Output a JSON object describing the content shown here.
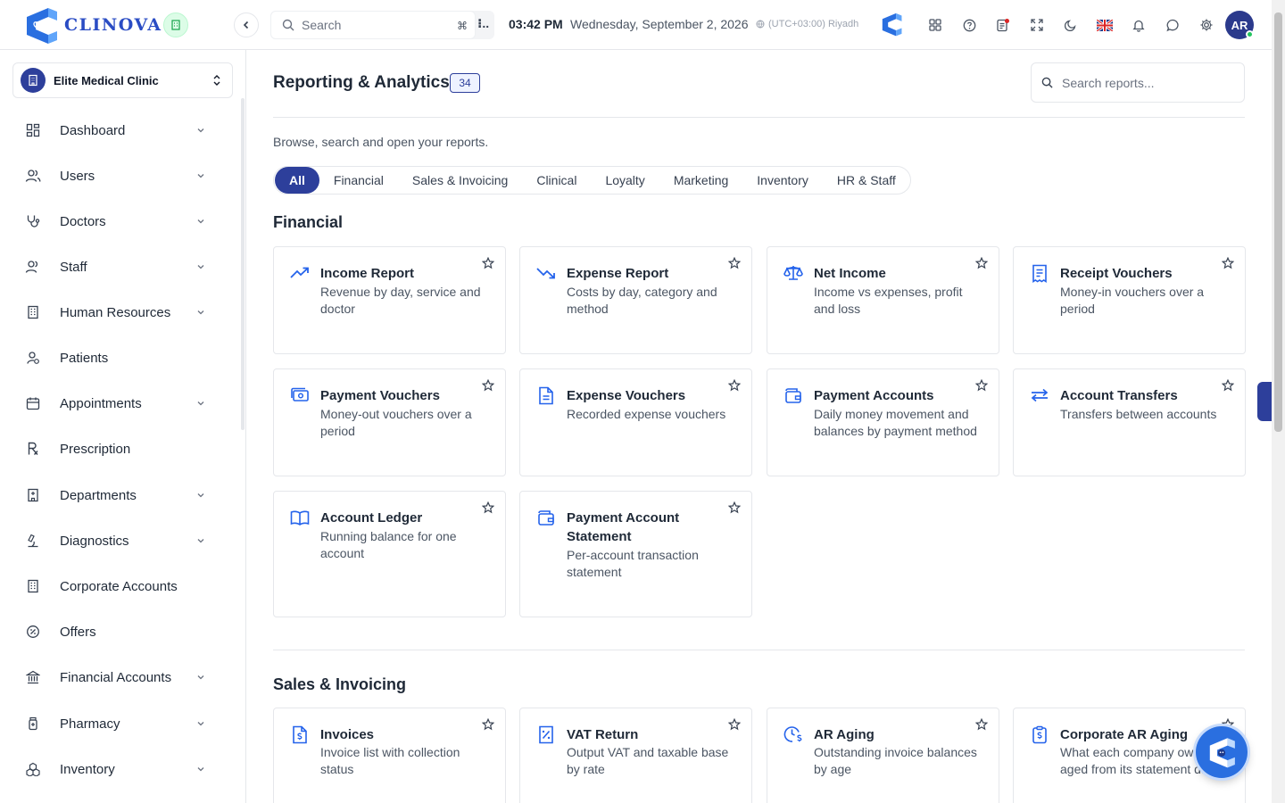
{
  "brand": {
    "name": "CLINOVA"
  },
  "header": {
    "search_placeholder": "Search",
    "shortcut": "⌘",
    "shortcut_more": "⁝..",
    "time": "03:42 PM",
    "date": "Wednesday, September 2, 2026",
    "timezone": "(UTC+03:00) Riyadh",
    "avatar_initials": "AR"
  },
  "sidebar": {
    "clinic": "Elite Medical Clinic",
    "items": [
      {
        "label": "Dashboard",
        "icon": "dashboard-icon",
        "has_children": true
      },
      {
        "label": "Users",
        "icon": "users-icon",
        "has_children": true
      },
      {
        "label": "Doctors",
        "icon": "stethoscope-icon",
        "has_children": true
      },
      {
        "label": "Staff",
        "icon": "staff-icon",
        "has_children": true
      },
      {
        "label": "Human Resources",
        "icon": "building-icon",
        "has_children": true
      },
      {
        "label": "Patients",
        "icon": "patient-icon",
        "has_children": false
      },
      {
        "label": "Appointments",
        "icon": "calendar-icon",
        "has_children": true
      },
      {
        "label": "Prescription",
        "icon": "rx-icon",
        "has_children": false
      },
      {
        "label": "Departments",
        "icon": "hospital-icon",
        "has_children": true
      },
      {
        "label": "Diagnostics",
        "icon": "microscope-icon",
        "has_children": true
      },
      {
        "label": "Corporate Accounts",
        "icon": "corporate-icon",
        "has_children": false
      },
      {
        "label": "Offers",
        "icon": "percent-icon",
        "has_children": false
      },
      {
        "label": "Financial Accounts",
        "icon": "bank-icon",
        "has_children": true
      },
      {
        "label": "Pharmacy",
        "icon": "pill-bottle-icon",
        "has_children": true
      },
      {
        "label": "Inventory",
        "icon": "boxes-icon",
        "has_children": true
      }
    ]
  },
  "main": {
    "title": "Reporting & Analytics",
    "count": "34",
    "search_placeholder": "Search reports...",
    "subtitle": "Browse, search and open your reports.",
    "tabs": [
      "All",
      "Financial",
      "Sales & Invoicing",
      "Clinical",
      "Loyalty",
      "Marketing",
      "Inventory",
      "HR & Staff"
    ],
    "active_tab": "All",
    "sections": [
      {
        "title": "Financial",
        "cards": [
          {
            "title": "Income Report",
            "desc": "Revenue by day, service and doctor",
            "icon": "trending-up-icon"
          },
          {
            "title": "Expense Report",
            "desc": "Costs by day, category and method",
            "icon": "trending-down-icon"
          },
          {
            "title": "Net Income",
            "desc": "Income vs expenses, profit and loss",
            "icon": "scale-icon"
          },
          {
            "title": "Receipt Vouchers",
            "desc": "Money-in vouchers over a period",
            "icon": "receipt-icon"
          },
          {
            "title": "Payment Vouchers",
            "desc": "Money-out vouchers over a period",
            "icon": "cash-icon"
          },
          {
            "title": "Expense Vouchers",
            "desc": "Recorded expense vouchers",
            "icon": "document-icon"
          },
          {
            "title": "Payment Accounts",
            "desc": "Daily money movement and balances by payment method",
            "icon": "wallet-icon"
          },
          {
            "title": "Account Transfers",
            "desc": "Transfers between accounts",
            "icon": "transfer-icon"
          },
          {
            "title": "Account Ledger",
            "desc": "Running balance for one account",
            "icon": "book-icon"
          },
          {
            "title": "Payment Account Statement",
            "desc": "Per-account transaction statement",
            "icon": "wallet-statement-icon"
          }
        ]
      },
      {
        "title": "Sales & Invoicing",
        "cards": [
          {
            "title": "Invoices",
            "desc": "Invoice list with collection status",
            "icon": "invoice-icon"
          },
          {
            "title": "VAT Return",
            "desc": "Output VAT and taxable base by rate",
            "icon": "percent-doc-icon"
          },
          {
            "title": "AR Aging",
            "desc": "Outstanding invoice balances by age",
            "icon": "clock-dollar-icon"
          },
          {
            "title": "Corporate AR Aging",
            "desc": "What each company owes, aged from its statement date",
            "icon": "clipboard-dollar-icon"
          }
        ]
      }
    ]
  },
  "colors": {
    "primary": "#2d3f9b",
    "accent_blue": "#2563eb",
    "border": "#e5e7eb"
  }
}
